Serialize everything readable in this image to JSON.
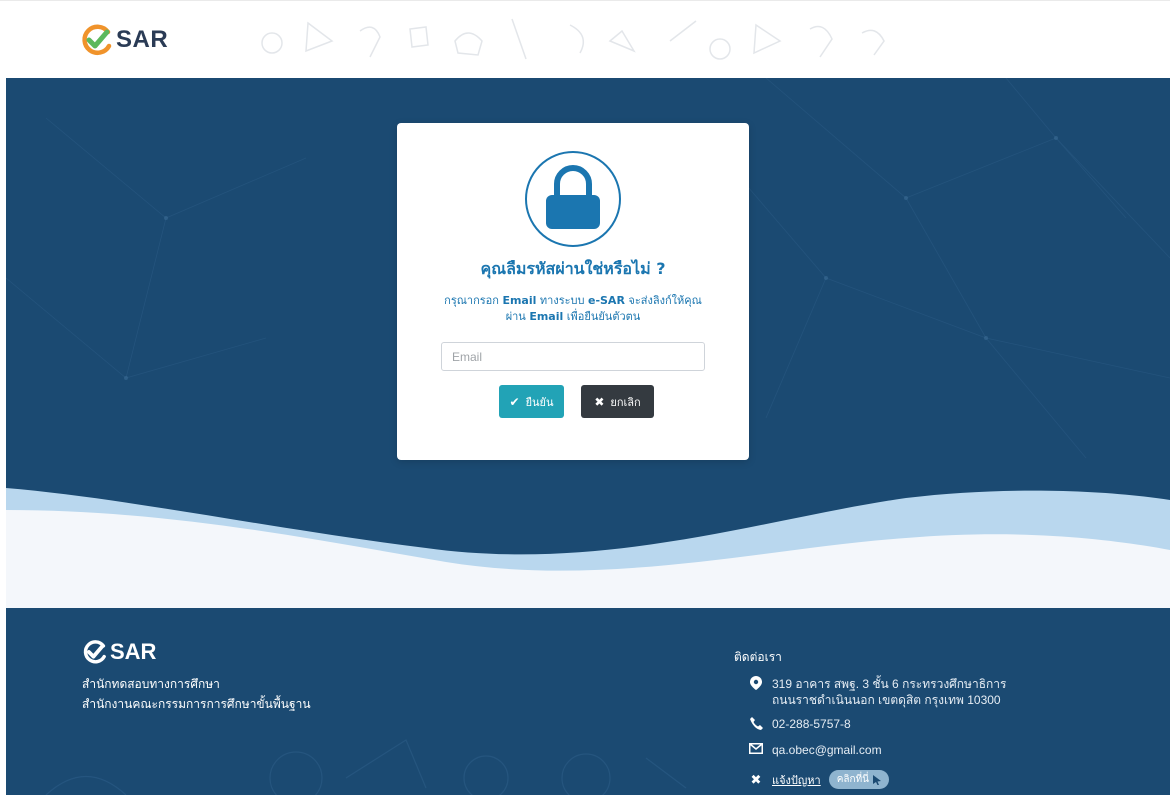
{
  "header": {
    "logo_text": "SAR"
  },
  "card": {
    "title": "คุณลืมรหัสผ่านใช่หรือไม่ ?",
    "desc_part1": "กรุณากรอก ",
    "desc_email1": "Email",
    "desc_part2": " ทางระบบ ",
    "desc_esar": "e-SAR",
    "desc_part3": " จะส่งลิงก์ให้คุณ",
    "desc_part4": "ผ่าน ",
    "desc_email2": "Email",
    "desc_part5": " เพื่อยืนยันตัวตน",
    "email_placeholder": "Email",
    "email_value": "",
    "confirm_label": "ยืนยัน",
    "cancel_label": "ยกเลิก"
  },
  "footer": {
    "logo_text": "SAR",
    "org_line1": "สำนักทดสอบทางการศึกษา",
    "org_line2": "สำนักงานคณะกรรมการการศึกษาขั้นพื้นฐาน",
    "contact_title": "ติดต่อเรา",
    "address_line1": "319 อาคาร สพฐ. 3 ชั้น 6 กระทรวงศึกษาธิการ",
    "address_line2": "ถนนราชดำเนินนอก เขตดุสิต กรุงเทพ 10300",
    "phone": "02-288-5757-8",
    "email": "qa.obec@gmail.com",
    "report_label": "แจ้งปัญหา",
    "click_label": "คลิกที่นี่"
  },
  "colors": {
    "brand_navy": "#1b4a72",
    "accent_blue": "#1b76b0",
    "confirm_teal": "#22a3b6",
    "cancel_dark": "#343a40",
    "logo_green": "#5cb85c",
    "logo_orange": "#f0932b"
  },
  "icons": {
    "logo": "check-badge-icon",
    "lock": "lock-icon",
    "confirm": "check-icon",
    "cancel": "close-icon",
    "location": "map-pin-icon",
    "phone": "phone-icon",
    "mail": "envelope-icon",
    "report": "tools-icon",
    "pointer": "cursor-icon"
  }
}
